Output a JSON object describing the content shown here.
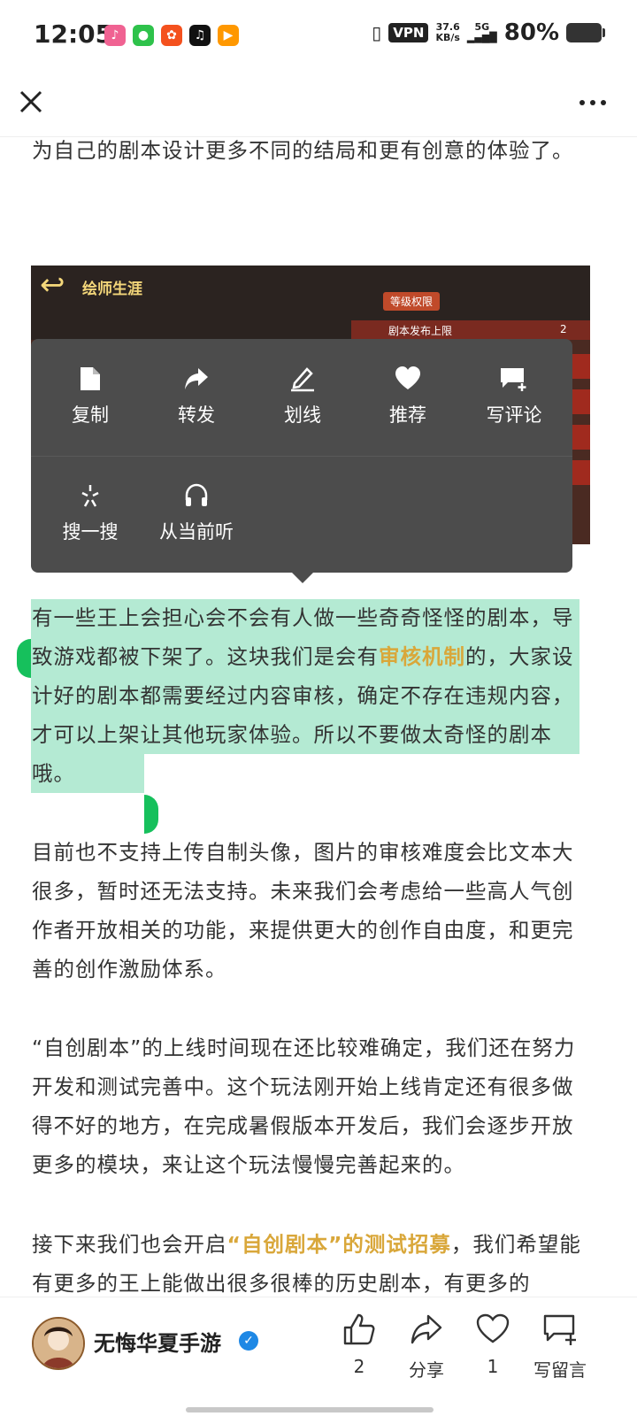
{
  "status_bar": {
    "time": "12:05",
    "vpn": "VPN",
    "net_speed_value": "37.6",
    "net_speed_unit": "KB/s",
    "signal": "5G",
    "battery": "80%",
    "battery_level": 0.8
  },
  "article": {
    "para1": "为自己的剧本设计更多不同的结局和更有创意的体验了。",
    "image": {
      "title": "绘师生涯",
      "label": "等级权限",
      "row_label": "剧本发布上限",
      "row_value": "2"
    },
    "para2_a": "有一些王上会担心会不会有人做一些奇奇怪怪的剧本，导致游戏都被下架了。这块我们是会有",
    "para2_hl": "审核机制",
    "para2_b": "的，大家设计好的剧本都需要经过内容审核，确定不存在违规内容，才可以上架让其他玩家体验。所以不要做太奇怪的剧本哦。",
    "para3": "目前也不支持上传自制头像，图片的审核难度会比文本大很多，暂时还无法支持。未来我们会考虑给一些高人气创作者开放相关的功能，来提供更大的创作自由度，和更完善的创作激励体系。",
    "para4": "“自创剧本”的上线时间现在还比较难确定，我们还在努力开发和测试完善中。这个玩法刚开始上线肯定还有很多做得不好的地方，在完成暑假版本开发后，我们会逐步开放更多的模块，来让这个玩法慢慢完善起来的。",
    "para5_a": "接下来我们也会开启",
    "para5_hl": "“自创剧本”的测试招募",
    "para5_b": "，我们希望能有更多的王上能做出很多很棒的历史剧本，有更多的"
  },
  "popup_menu": {
    "copy": "复制",
    "forward": "转发",
    "underline": "划线",
    "recommend": "推荐",
    "comment": "写评论",
    "search": "搜一搜",
    "listen": "从当前听"
  },
  "bottom_bar": {
    "author": "无悔华夏手游",
    "like_count": "2",
    "share": "分享",
    "recommend_count": "1",
    "comment": "写留言"
  },
  "colors": {
    "highlight": "#d9a73a",
    "selection": "#b4ead3",
    "handle": "#16c05c",
    "popup_bg": "#4c4c4c"
  }
}
